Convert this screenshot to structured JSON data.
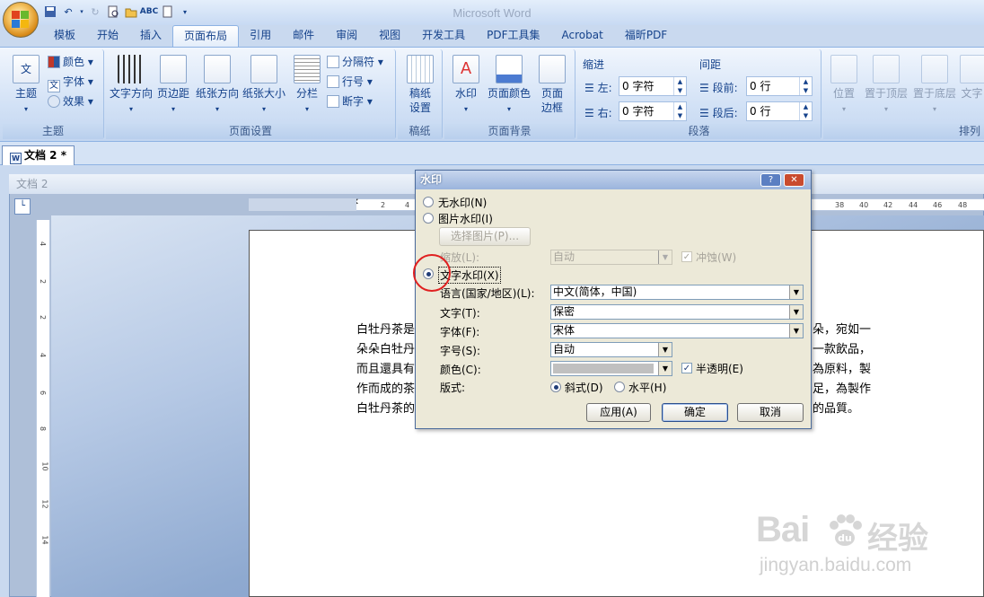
{
  "window": {
    "title": "Microsoft Word"
  },
  "tabs": [
    "模板",
    "开始",
    "插入",
    "页面布局",
    "引用",
    "邮件",
    "审阅",
    "视图",
    "开发工具",
    "PDF工具集",
    "Acrobat",
    "福昕PDF"
  ],
  "active_tab": "页面布局",
  "ribbon": {
    "theme_group": {
      "title": "主题",
      "big_button": "主题",
      "colors": "颜色",
      "fonts": "字体",
      "effects": "效果"
    },
    "page_setup": {
      "title": "页面设置",
      "text_direction": "文字方向",
      "margins": "页边距",
      "orientation": "纸张方向",
      "size": "纸张大小",
      "columns": "分栏",
      "breaks": "分隔符",
      "line_numbers": "行号",
      "hyphenation": "断字"
    },
    "draft": {
      "title": "稿纸",
      "button": "稿纸\n设置",
      "line1": "稿纸",
      "line2": "设置"
    },
    "background": {
      "title": "页面背景",
      "watermark": "水印",
      "page_color": "页面颜色",
      "borders_l1": "页面",
      "borders_l2": "边框"
    },
    "paragraph": {
      "title": "段落",
      "indent_label": "缩进",
      "spacing_label": "间距",
      "left_label": "左:",
      "left_value": "0 字符",
      "right_label": "右:",
      "right_value": "0 字符",
      "before_label": "段前:",
      "before_value": "0 行",
      "after_label": "段后:",
      "after_value": "0 行"
    },
    "arrange": {
      "title": "排列",
      "position": "位置",
      "bring_front": "置于顶层",
      "send_back": "置于底层",
      "text_wrap": "文字"
    }
  },
  "document": {
    "tab_label": "文档 2 *",
    "caption": "文档 2",
    "ruler_h": [
      "8",
      "6",
      "4",
      "2",
      "2",
      "4",
      "38",
      "40",
      "42",
      "44",
      "46",
      "48"
    ],
    "ruler_v": [
      "4",
      "2",
      "2",
      "4",
      "6",
      "8",
      "10",
      "12",
      "14"
    ],
    "lines": [
      {
        "left": "白牡丹茶是",
        "right": "朵，宛如一"
      },
      {
        "left": "朵朵白牡丹",
        "right": "一款飲品，"
      },
      {
        "left": "而且還具有",
        "right": "為原料，製"
      },
      {
        "left": "作而成的茶",
        "right": "足，為製作"
      },
      {
        "left": "白牡丹茶的",
        "right": "的品質。"
      }
    ]
  },
  "dialog": {
    "title": "水印",
    "help_btn": "?",
    "close_btn": "✕",
    "no_watermark": "无水印(N)",
    "picture_watermark": "图片水印(I)",
    "select_picture": "选择图片(P)...",
    "scale_label": "缩放(L):",
    "scale_value": "自动",
    "washout": "冲蚀(W)",
    "text_watermark": "文字水印(X)",
    "language_label": "语言(国家/地区)(L):",
    "language_value": "中文(简体，中国)",
    "text_label": "文字(T):",
    "text_value": "保密",
    "font_label": "字体(F):",
    "font_value": "宋体",
    "size_label": "字号(S):",
    "size_value": "自动",
    "color_label": "颜色(C):",
    "semitransparent": "半透明(E)",
    "layout_label": "版式:",
    "diagonal": "斜式(D)",
    "horizontal": "水平(H)",
    "apply": "应用(A)",
    "ok": "确定",
    "cancel": "取消",
    "selected": "text"
  },
  "watermark_overlay": {
    "brand": "Bai",
    "brand2": "经验",
    "url": "jingyan.baidu.com"
  },
  "colors": {
    "accent": "#15428b",
    "highlight_circle": "#e02020"
  }
}
